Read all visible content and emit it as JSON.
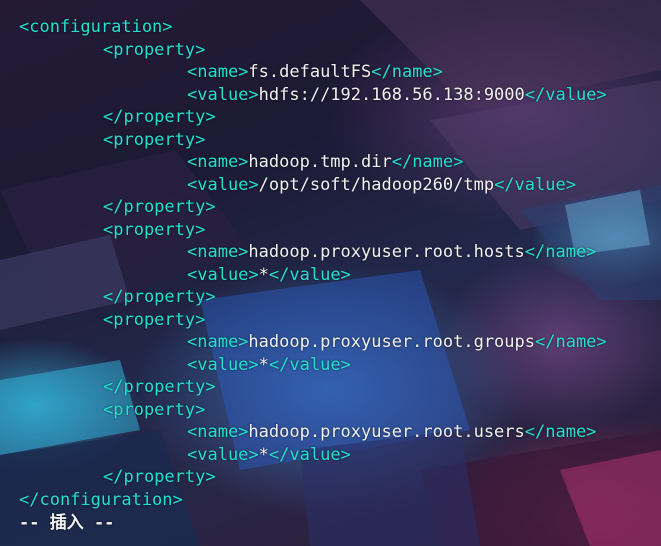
{
  "theme": {
    "tag_color": "#22e1cf",
    "text_color": "#f2f2f2"
  },
  "xml": {
    "config_open": "<configuration>",
    "config_close": "</configuration>",
    "property_open": "<property>",
    "property_close": "</property>",
    "name_open": "<name>",
    "name_close": "</name>",
    "value_open": "<value>",
    "value_close": "</value>"
  },
  "properties": [
    {
      "name": "fs.defaultFS",
      "value": "hdfs://192.168.56.138:9000"
    },
    {
      "name": "hadoop.tmp.dir",
      "value": "/opt/soft/hadoop260/tmp"
    },
    {
      "name": "hadoop.proxyuser.root.hosts",
      "value": "*"
    },
    {
      "name": "hadoop.proxyuser.root.groups",
      "value": "*"
    },
    {
      "name": "hadoop.proxyuser.root.users",
      "value": "*"
    }
  ],
  "status_line": "-- 插入 --"
}
